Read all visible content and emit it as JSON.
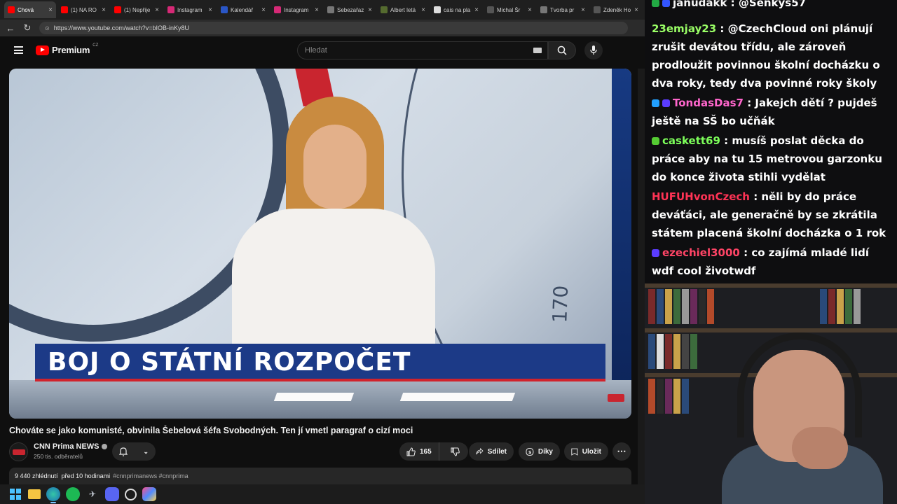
{
  "browser": {
    "tabs": [
      {
        "label": "Chová",
        "color": "#ff0000",
        "active": true
      },
      {
        "label": "(1) NA RO",
        "color": "#ff0000"
      },
      {
        "label": "(1) Nepřije",
        "color": "#ff0000"
      },
      {
        "label": "Instagram",
        "color": "#d62976"
      },
      {
        "label": "Kalendář",
        "color": "#2a56c6"
      },
      {
        "label": "Instagram",
        "color": "#d62976"
      },
      {
        "label": "Sebezařaz",
        "color": "#777777"
      },
      {
        "label": "Albert letá",
        "color": "#556b2f"
      },
      {
        "label": "cais na pla",
        "color": "#dddddd"
      },
      {
        "label": "Michal Šr",
        "color": "#555555"
      },
      {
        "label": "Tvorba pr",
        "color": "#777777"
      },
      {
        "label": "Zdeněk Ho",
        "color": "#555555"
      }
    ],
    "url": "https://www.youtube.com/watch?v=bIOB-inKy8U"
  },
  "youtube": {
    "logo_text": "Premium",
    "logo_region": "CZ",
    "search_placeholder": "Hledat",
    "video_overlay_headline": "BOJ O STÁTNÍ ROZPOČET",
    "video_scale_number": "170",
    "video_title": "Chováte se jako komunisté, obvinila Šebelová šéfa Svobodných. Ten jí vmetl paragraf o cizí moci",
    "channel_name": "CNN Prima NEWS",
    "channel_subs": "250 tis. odběratelů",
    "like_count": "165",
    "share_label": "Sdílet",
    "thanks_label": "Díky",
    "save_label": "Uložit",
    "views": "9 440 zhlédnutí",
    "published": "před 10 hodinami",
    "hashtags": "#cnnprimanews #cnnprima"
  },
  "chat": {
    "messages": [
      {
        "user": "janudakk",
        "user_color": "#f5f5f5",
        "text": ": @Senkys57",
        "badges": [
          "#22aa44",
          "#3355ff"
        ]
      },
      {
        "user": "23emjay23",
        "user_color": "#9aff66",
        "text": ": @CzechCloud oni plánují zrušit devátou třídu, ale zároveň prodloužit povinnou školní docházku o dva roky, tedy dva povinné roky školy",
        "badges": []
      },
      {
        "user": "TondasDas7",
        "user_color": "#ff66cc",
        "text": ": Jakejch dětí ? pujdeš ještě na SŠ bo učňák",
        "badges": [
          "#22a0ff",
          "#5b3cff"
        ]
      },
      {
        "user": "caskett69",
        "user_color": "#7dff5a",
        "text": ": musíš poslat děcka do práce aby na tu 15 metrovou garzonku do konce života stihli vydělat",
        "badges": [
          "#55cc33"
        ]
      },
      {
        "user": "HUFUHvonCzech",
        "user_color": "#ff3355",
        "text": ": něli by do práce deváťáci, ale generačně by se zkrátila státem placená školní docházka o 1 rok",
        "badges": []
      },
      {
        "user": "ezechiel3000",
        "user_color": "#ff4466",
        "text": ": co zajímá mladé lidí wdf cool životwdf",
        "badges": [
          "#5b3cff"
        ]
      }
    ]
  }
}
